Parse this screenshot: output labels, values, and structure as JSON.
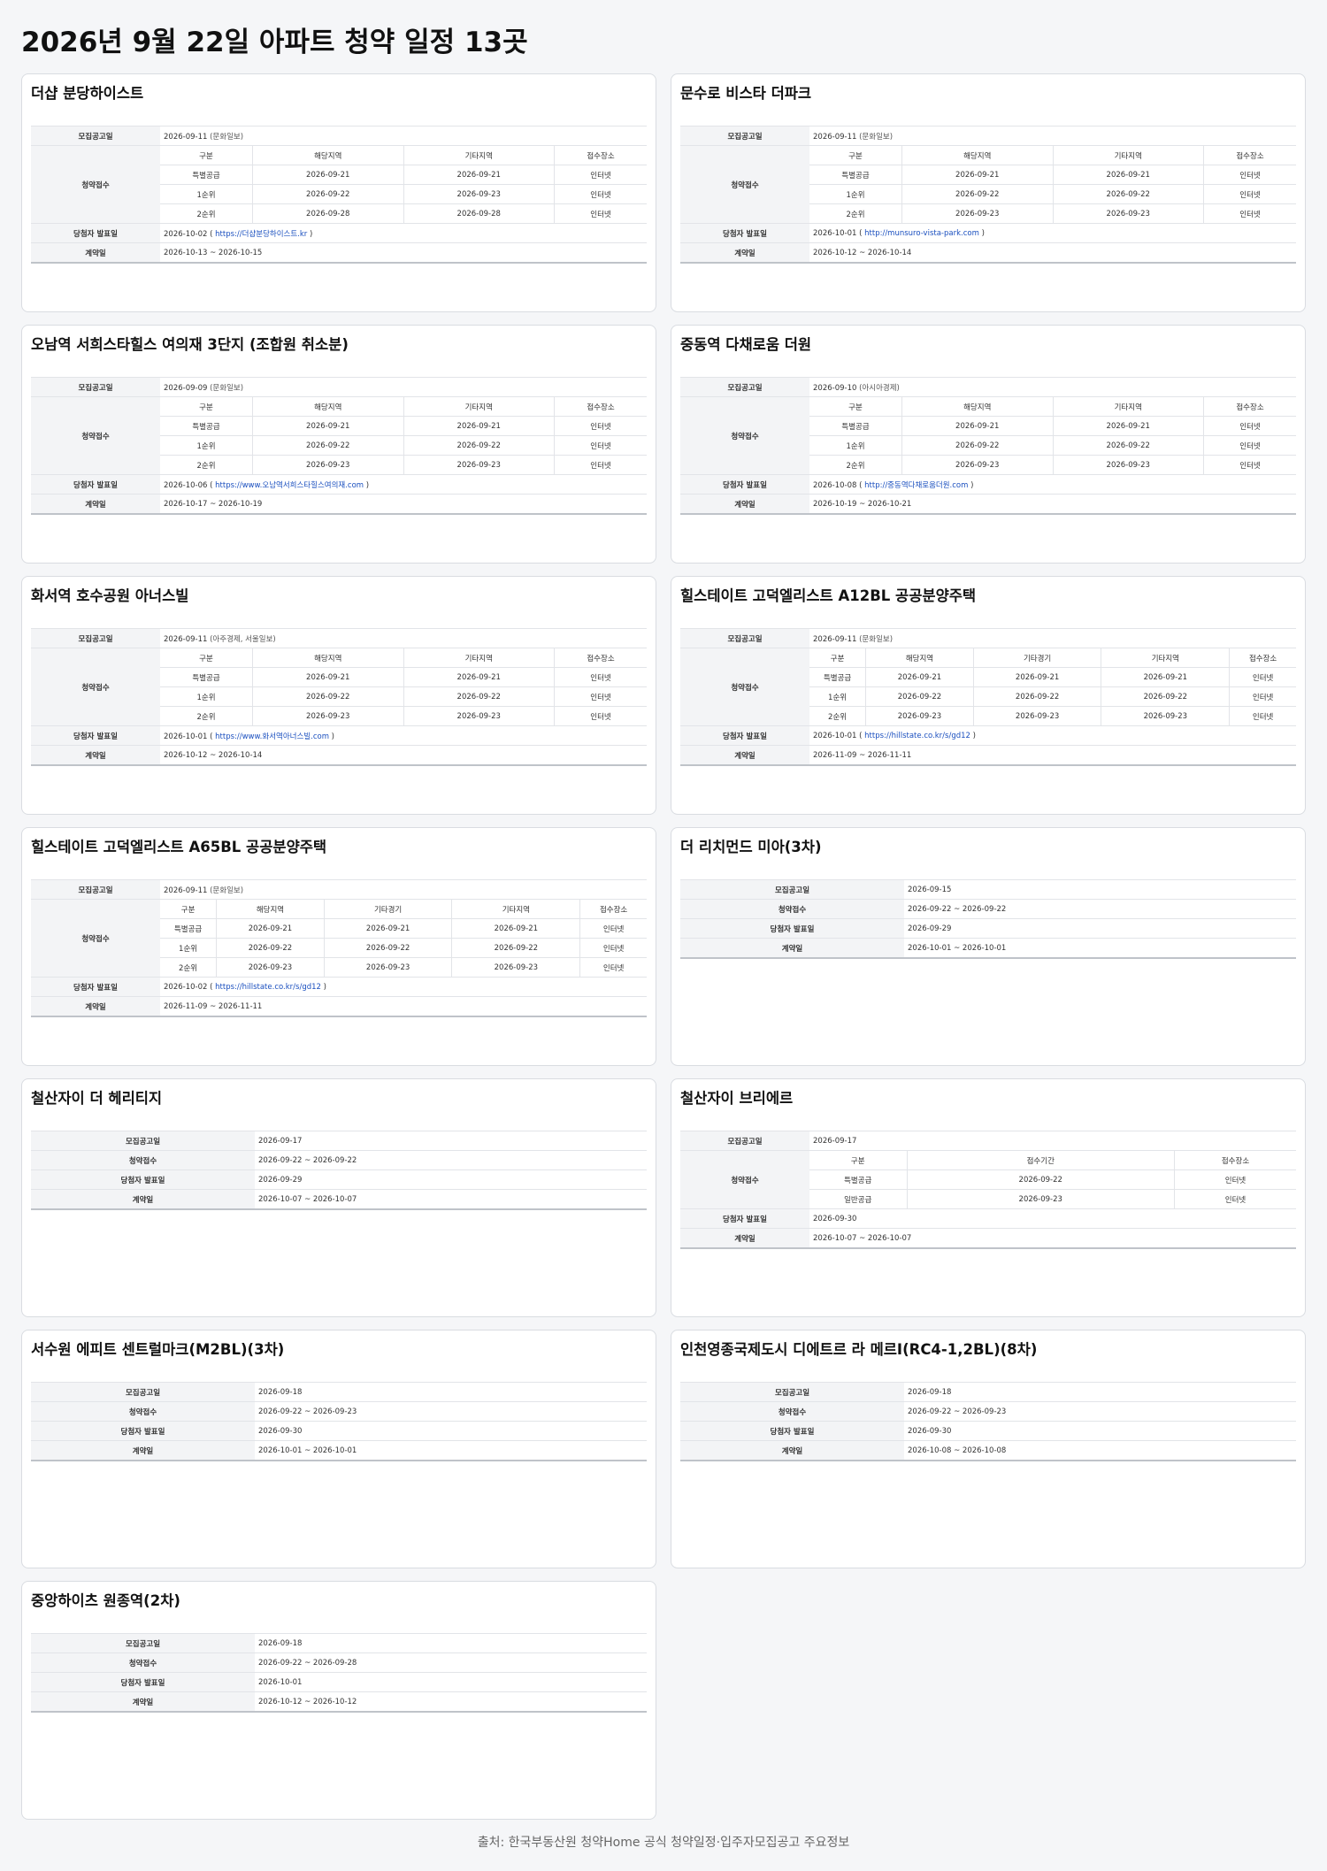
{
  "page": {
    "title": "2026년 9월 22일 아파트 청약 일정 13곳",
    "source": "출처: 한국부동산원 청약Home 공식 청약일정·입주자모집공고 주요정보"
  },
  "labels": {
    "notice_date": "모집공고일",
    "subscription": "청약접수",
    "winner": "당첨자 발표일",
    "contract": "계약일"
  },
  "cards": [
    {
      "title": "더샵 분당하이스트",
      "notice": {
        "date": "2026-09-11",
        "paper": "(문화일보)"
      },
      "sub_headers": [
        "구분",
        "해당지역",
        "기타지역",
        "접수장소"
      ],
      "sub_rows": [
        [
          "특별공급",
          "2026-09-21",
          "2026-09-21",
          "인터넷"
        ],
        [
          "1순위",
          "2026-09-22",
          "2026-09-23",
          "인터넷"
        ],
        [
          "2순위",
          "2026-09-28",
          "2026-09-28",
          "인터넷"
        ]
      ],
      "winner": {
        "date": "2026-10-02",
        "url": "https://더샵분당하이스트.kr"
      },
      "contract": "2026-10-13 ~ 2026-10-15"
    },
    {
      "title": "문수로 비스타 더파크",
      "notice": {
        "date": "2026-09-11",
        "paper": "(문화일보)"
      },
      "sub_headers": [
        "구분",
        "해당지역",
        "기타지역",
        "접수장소"
      ],
      "sub_rows": [
        [
          "특별공급",
          "2026-09-21",
          "2026-09-21",
          "인터넷"
        ],
        [
          "1순위",
          "2026-09-22",
          "2026-09-22",
          "인터넷"
        ],
        [
          "2순위",
          "2026-09-23",
          "2026-09-23",
          "인터넷"
        ]
      ],
      "winner": {
        "date": "2026-10-01",
        "url": "http://munsuro-vista-park.com"
      },
      "contract": "2026-10-12 ~ 2026-10-14"
    },
    {
      "title": "오남역 서희스타힐스 여의재 3단지 (조합원 취소분)",
      "notice": {
        "date": "2026-09-09",
        "paper": "(문화일보)"
      },
      "sub_headers": [
        "구분",
        "해당지역",
        "기타지역",
        "접수장소"
      ],
      "sub_rows": [
        [
          "특별공급",
          "2026-09-21",
          "2026-09-21",
          "인터넷"
        ],
        [
          "1순위",
          "2026-09-22",
          "2026-09-22",
          "인터넷"
        ],
        [
          "2순위",
          "2026-09-23",
          "2026-09-23",
          "인터넷"
        ]
      ],
      "winner": {
        "date": "2026-10-06",
        "url": "https://www.오남역서희스타힐스여의재.com"
      },
      "contract": "2026-10-17 ~ 2026-10-19"
    },
    {
      "title": "중동역 다채로움 더원",
      "notice": {
        "date": "2026-09-10",
        "paper": "(아시아경제)"
      },
      "sub_headers": [
        "구분",
        "해당지역",
        "기타지역",
        "접수장소"
      ],
      "sub_rows": [
        [
          "특별공급",
          "2026-09-21",
          "2026-09-21",
          "인터넷"
        ],
        [
          "1순위",
          "2026-09-22",
          "2026-09-22",
          "인터넷"
        ],
        [
          "2순위",
          "2026-09-23",
          "2026-09-23",
          "인터넷"
        ]
      ],
      "winner": {
        "date": "2026-10-08",
        "url": "http://중동역다채로움더원.com"
      },
      "contract": "2026-10-19 ~ 2026-10-21"
    },
    {
      "title": "화서역 호수공원 아너스빌",
      "notice": {
        "date": "2026-09-11",
        "paper": "(아주경제, 서울일보)"
      },
      "sub_headers": [
        "구분",
        "해당지역",
        "기타지역",
        "접수장소"
      ],
      "sub_rows": [
        [
          "특별공급",
          "2026-09-21",
          "2026-09-21",
          "인터넷"
        ],
        [
          "1순위",
          "2026-09-22",
          "2026-09-22",
          "인터넷"
        ],
        [
          "2순위",
          "2026-09-23",
          "2026-09-23",
          "인터넷"
        ]
      ],
      "winner": {
        "date": "2026-10-01",
        "url": "https://www.화서역아너스빌.com"
      },
      "contract": "2026-10-12 ~ 2026-10-14"
    },
    {
      "title": "힐스테이트 고덕엘리스트 A12BL 공공분양주택",
      "notice": {
        "date": "2026-09-11",
        "paper": "(문화일보)"
      },
      "sub_headers": [
        "구분",
        "해당지역",
        "기타경기",
        "기타지역",
        "접수장소"
      ],
      "sub_rows": [
        [
          "특별공급",
          "2026-09-21",
          "2026-09-21",
          "2026-09-21",
          "인터넷"
        ],
        [
          "1순위",
          "2026-09-22",
          "2026-09-22",
          "2026-09-22",
          "인터넷"
        ],
        [
          "2순위",
          "2026-09-23",
          "2026-09-23",
          "2026-09-23",
          "인터넷"
        ]
      ],
      "winner": {
        "date": "2026-10-01",
        "url": "https://hillstate.co.kr/s/gd12"
      },
      "contract": "2026-11-09 ~ 2026-11-11"
    },
    {
      "title": "힐스테이트 고덕엘리스트 A65BL 공공분양주택",
      "notice": {
        "date": "2026-09-11",
        "paper": "(문화일보)"
      },
      "sub_headers": [
        "구분",
        "해당지역",
        "기타경기",
        "기타지역",
        "접수장소"
      ],
      "sub_rows": [
        [
          "특별공급",
          "2026-09-21",
          "2026-09-21",
          "2026-09-21",
          "인터넷"
        ],
        [
          "1순위",
          "2026-09-22",
          "2026-09-22",
          "2026-09-22",
          "인터넷"
        ],
        [
          "2순위",
          "2026-09-23",
          "2026-09-23",
          "2026-09-23",
          "인터넷"
        ]
      ],
      "winner": {
        "date": "2026-10-02",
        "url": "https://hillstate.co.kr/s/gd12"
      },
      "contract": "2026-11-09 ~ 2026-11-11"
    },
    {
      "title": "더 리치먼드 미아(3차)",
      "notice": {
        "date": "2026-09-15",
        "paper": ""
      },
      "subscription": "2026-09-22 ~ 2026-09-22",
      "winner": {
        "date": "2026-09-29",
        "url": ""
      },
      "contract": "2026-10-01 ~ 2026-10-01"
    },
    {
      "title": "철산자이 더 헤리티지",
      "notice": {
        "date": "2026-09-17",
        "paper": ""
      },
      "subscription": "2026-09-22 ~ 2026-09-22",
      "winner": {
        "date": "2026-09-29",
        "url": ""
      },
      "contract": "2026-10-07 ~ 2026-10-07"
    },
    {
      "title": "철산자이 브리에르",
      "notice": {
        "date": "2026-09-17",
        "paper": ""
      },
      "sub_headers": [
        "구분",
        "접수기간",
        "접수장소"
      ],
      "sub_rows": [
        [
          "특별공급",
          "2026-09-22",
          "인터넷"
        ],
        [
          "일반공급",
          "2026-09-23",
          "인터넷"
        ]
      ],
      "winner": {
        "date": "2026-09-30",
        "url": ""
      },
      "contract": "2026-10-07 ~ 2026-10-07"
    },
    {
      "title": "서수원 에피트 센트럴마크(M2BL)(3차)",
      "notice": {
        "date": "2026-09-18",
        "paper": ""
      },
      "subscription": "2026-09-22 ~ 2026-09-23",
      "winner": {
        "date": "2026-09-30",
        "url": ""
      },
      "contract": "2026-10-01 ~ 2026-10-01"
    },
    {
      "title": "인천영종국제도시 디에트르 라 메르Ⅰ(RC4-1,2BL)(8차)",
      "notice": {
        "date": "2026-09-18",
        "paper": ""
      },
      "subscription": "2026-09-22 ~ 2026-09-23",
      "winner": {
        "date": "2026-09-30",
        "url": ""
      },
      "contract": "2026-10-08 ~ 2026-10-08"
    },
    {
      "title": "중앙하이츠 원종역(2차)",
      "notice": {
        "date": "2026-09-18",
        "paper": ""
      },
      "subscription": "2026-09-22 ~ 2026-09-28",
      "winner": {
        "date": "2026-10-01",
        "url": ""
      },
      "contract": "2026-10-12 ~ 2026-10-12"
    }
  ]
}
